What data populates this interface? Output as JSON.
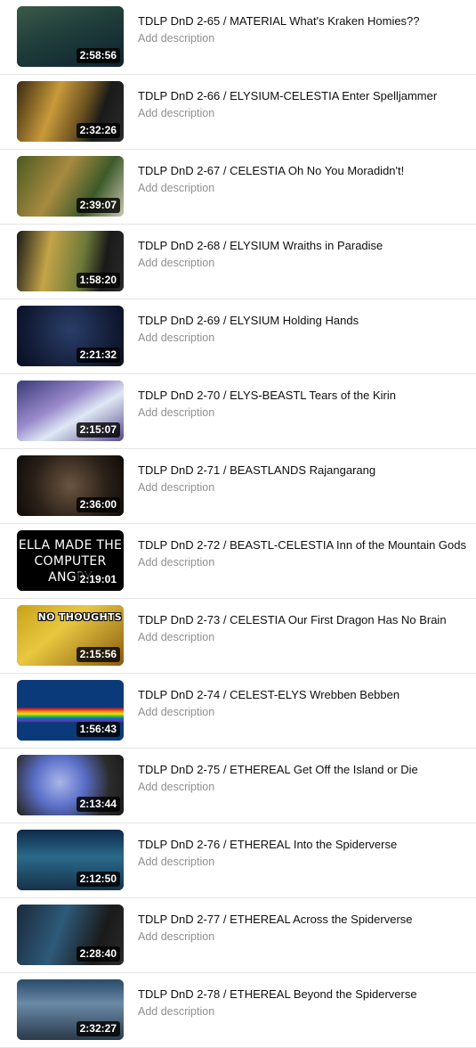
{
  "add_description_label": "Add description",
  "videos": [
    {
      "title": "TDLP DnD 2-65 / MATERIAL What's Kraken Homies??",
      "duration": "2:58:56",
      "thumb_icon": "kraken-ship-art",
      "thumb_text": "",
      "bg": "linear-gradient(160deg,#3b5a4a 0%,#1f3d3a 45%,#0e2230 100%)"
    },
    {
      "title": "TDLP DnD 2-66 / ELYSIUM-CELESTIA Enter Spelljammer",
      "duration": "2:32:26",
      "thumb_icon": "golden-landscape-art",
      "thumb_text": "",
      "bg": "linear-gradient(110deg,#3a2a10 0%,#c99a3a 35%,#6b5220 60%,#1a1a1a 75%,#2b2b2b 100%)"
    },
    {
      "title": "TDLP DnD 2-67 / CELESTIA Oh No You Moradidn't!",
      "duration": "2:39:07",
      "thumb_icon": "forest-characters-art",
      "thumb_text": "",
      "bg": "linear-gradient(120deg,#4a5a20 0%,#a88a40 40%,#3d5a2a 70%,#c8c8b0 100%)"
    },
    {
      "title": "TDLP DnD 2-68 / ELYSIUM Wraiths in Paradise",
      "duration": "1:58:20",
      "thumb_icon": "paradise-map-art",
      "thumb_text": "",
      "bg": "linear-gradient(100deg,#1a1a1a 0%,#c4a448 30%,#6e7a3a 60%,#1a1a1a 80%,#2a2a2a 100%)"
    },
    {
      "title": "TDLP DnD 2-69 / ELYSIUM Holding Hands",
      "duration": "2:21:32",
      "thumb_icon": "constellation-art",
      "thumb_text": "",
      "bg": "radial-gradient(circle at 50% 40%,#2a3e6a 0%,#111a33 70%,#0a0f1f 100%)"
    },
    {
      "title": "TDLP DnD 2-70 / ELYS-BEASTL Tears of the Kirin",
      "duration": "2:15:07",
      "thumb_icon": "kirin-art",
      "thumb_text": "",
      "bg": "linear-gradient(150deg,#3a3a7a 0%,#9a8acb 40%,#dfe8f5 60%,#5a4a8a 100%)"
    },
    {
      "title": "TDLP DnD 2-71 / BEASTLANDS Rajangarang",
      "duration": "2:36:00",
      "thumb_icon": "horned-beast-art",
      "thumb_text": "",
      "bg": "radial-gradient(circle at 50% 50%,#6b5540 0%,#2a2018 60%,#0f0b08 100%)"
    },
    {
      "title": "TDLP DnD 2-72 / BEASTL-CELESTIA Inn of the Mountain Gods",
      "duration": "2:19:01",
      "thumb_icon": "text-card",
      "thumb_text": "ELLA MADE THE COMPUTER ANGRY",
      "bg": "#000000"
    },
    {
      "title": "TDLP DnD 2-73 / CELESTIA Our First Dragon Has No Brain",
      "duration": "2:15:56",
      "thumb_icon": "gold-dragon-art",
      "thumb_text": "NO THOUGHTS",
      "bg": "linear-gradient(140deg,#c9a11a 0%,#e8c840 40%,#8a5a10 100%)"
    },
    {
      "title": "TDLP DnD 2-74 / CELEST-ELYS Wrebben Bebben",
      "duration": "1:56:43",
      "thumb_icon": "nyan-cat-art",
      "thumb_text": "",
      "bg": "linear-gradient(180deg,#0b3a7a 0%,#0b3a7a 45%,#e02020 48%,#f08a10 52%,#f0e010 56%,#30c030 60%,#1060e0 64%,#7030a0 68%,#0b3a7a 70%,#0b3a7a 100%)"
    },
    {
      "title": "TDLP DnD 2-75 / ETHEREAL Get Off the Island or Die",
      "duration": "2:13:44",
      "thumb_icon": "island-map-art",
      "thumb_text": "",
      "bg": "radial-gradient(circle at 40% 45%,#a9b6e8 0%,#5a6ec8 35%,#2b2b2b 70%,#1a1a1a 100%)"
    },
    {
      "title": "TDLP DnD 2-76 / ETHEREAL Into the Spiderverse",
      "duration": "2:12:50",
      "thumb_icon": "night-island-art",
      "thumb_text": "",
      "bg": "linear-gradient(180deg,#0e2a4a 0%,#2a6a8a 45%,#16324a 100%)"
    },
    {
      "title": "TDLP DnD 2-77 / ETHEREAL Across the Spiderverse",
      "duration": "2:28:40",
      "thumb_icon": "spiderverse-map-art",
      "thumb_text": "",
      "bg": "linear-gradient(110deg,#1a2a3a 0%,#2e5a7a 40%,#1a1a1a 75%,#2a2a2a 100%)"
    },
    {
      "title": "TDLP DnD 2-78 / ETHEREAL Beyond the Spiderverse",
      "duration": "2:32:27",
      "thumb_icon": "mountain-valley-art",
      "thumb_text": "",
      "bg": "linear-gradient(180deg,#2a4a6a 0%,#6a8aa8 40%,#2a3a4a 100%)"
    }
  ]
}
